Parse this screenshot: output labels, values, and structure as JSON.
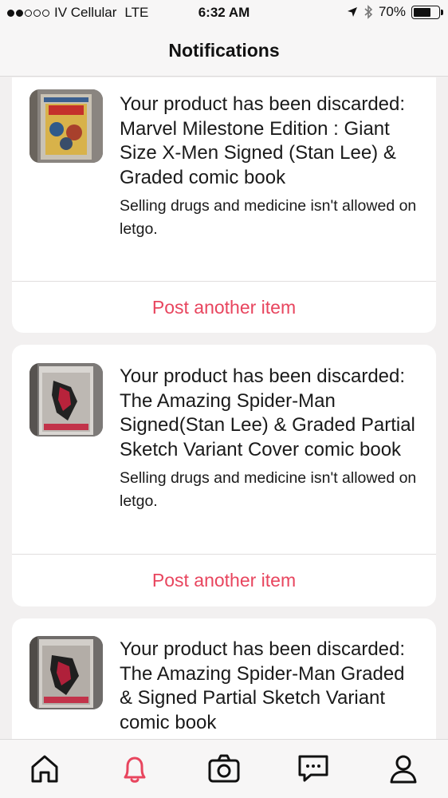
{
  "status_bar": {
    "carrier": "IV Cellular",
    "network": "LTE",
    "time": "6:32 AM",
    "battery": "70%",
    "battery_level": 0.7
  },
  "nav": {
    "title": "Notifications"
  },
  "notifications": [
    {
      "title": "Your product has been discarded: Marvel Milestone Edition : Giant Size X-Men Signed (Stan Lee) & Graded comic book",
      "reason": "Selling drugs and medicine isn't allowed on letgo.",
      "action": "Post another item",
      "thumbnail": "comic-xmen-thumbnail"
    },
    {
      "title": "Your product has been discarded: The Amazing Spider-Man Signed(Stan Lee) & Graded Partial Sketch Variant Cover comic book",
      "reason": "Selling drugs and medicine isn't allowed on letgo.",
      "action": "Post another item",
      "thumbnail": "comic-spiderman-thumbnail"
    },
    {
      "title": "Your product has been discarded: The Amazing Spider-Man Graded & Signed Partial Sketch Variant comic book",
      "reason": "",
      "action": "",
      "thumbnail": "comic-spiderman-thumbnail"
    }
  ],
  "colors": {
    "accent": "#e8455e",
    "background": "#f2f0f0",
    "card": "#ffffff"
  },
  "tabs": [
    {
      "icon": "home-icon",
      "active": false
    },
    {
      "icon": "bell-icon",
      "active": true
    },
    {
      "icon": "camera-icon",
      "active": false
    },
    {
      "icon": "chat-icon",
      "active": false
    },
    {
      "icon": "profile-icon",
      "active": false
    }
  ]
}
